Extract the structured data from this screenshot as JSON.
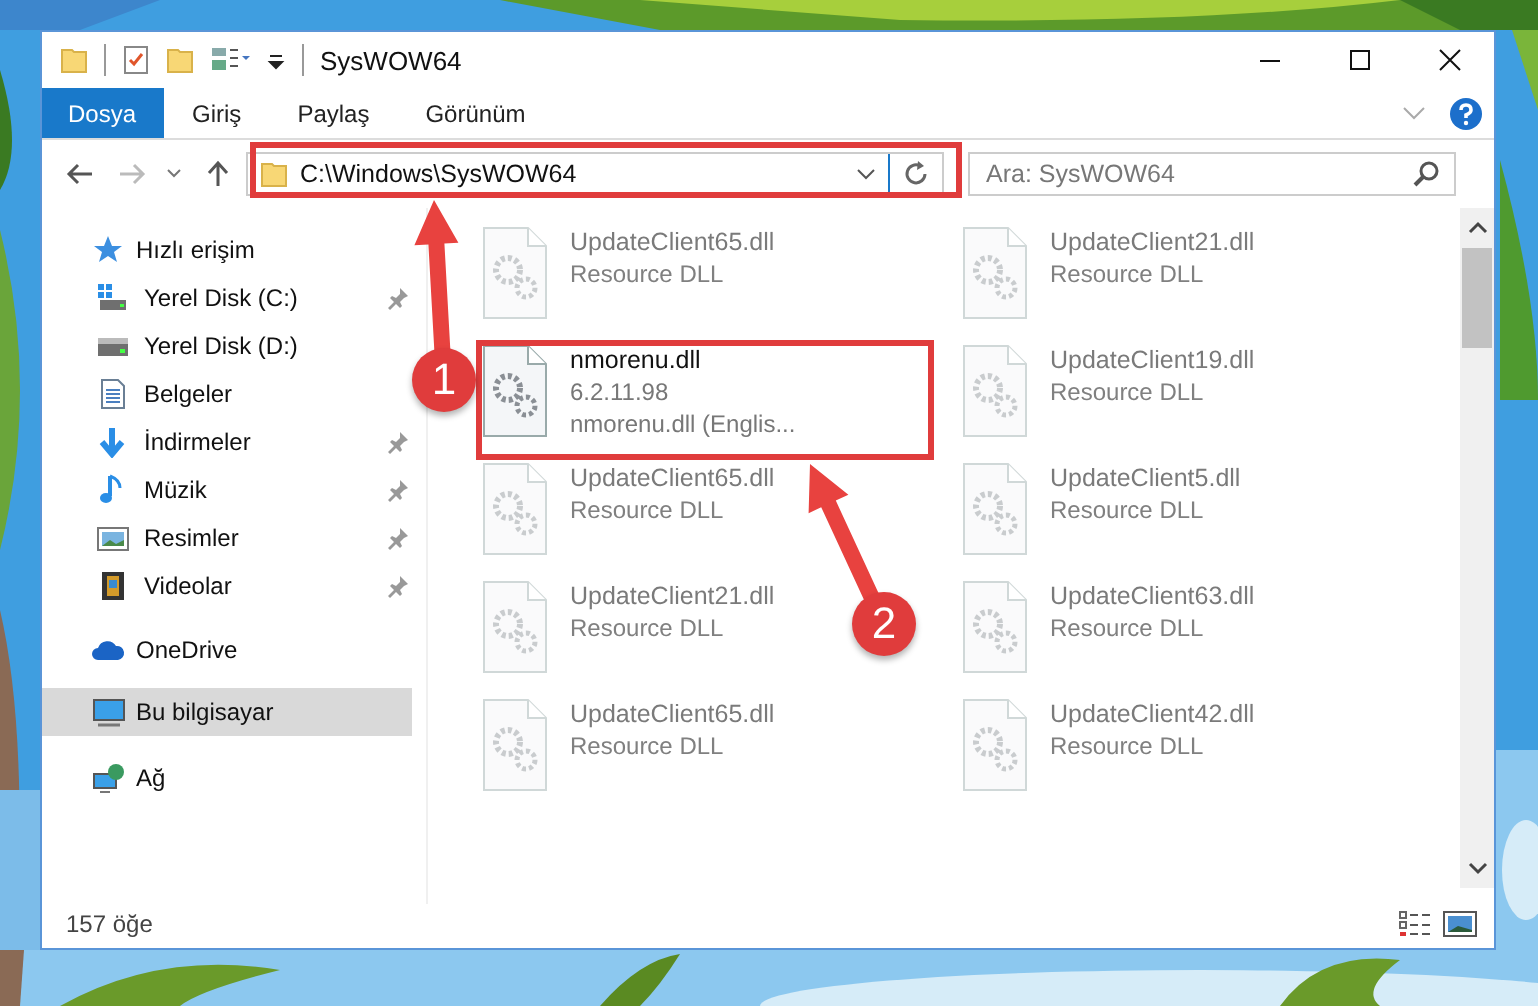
{
  "window": {
    "title": "SysWOW64"
  },
  "ribbon": {
    "tabs": [
      {
        "label": "Dosya",
        "selected": true
      },
      {
        "label": "Giriş",
        "selected": false
      },
      {
        "label": "Paylaş",
        "selected": false
      },
      {
        "label": "Görünüm",
        "selected": false
      }
    ]
  },
  "address_bar": {
    "path": "C:\\Windows\\SysWOW64"
  },
  "search": {
    "placeholder": "Ara: SysWOW64"
  },
  "sidebar": {
    "items": [
      {
        "label": "Hızlı erişim",
        "kind": "star",
        "selected": false,
        "children": [
          {
            "label": "Yerel Disk (C:)",
            "kind": "sysdrive",
            "pinned": true,
            "selected": false
          },
          {
            "label": "Yerel Disk (D:)",
            "kind": "drive",
            "pinned": false,
            "selected": false
          },
          {
            "label": "Belgeler",
            "kind": "document",
            "pinned": false,
            "selected": false
          },
          {
            "label": "İndirmeler",
            "kind": "download",
            "pinned": true,
            "selected": false
          },
          {
            "label": "Müzik",
            "kind": "music",
            "pinned": true,
            "selected": false
          },
          {
            "label": "Resimler",
            "kind": "picture",
            "pinned": true,
            "selected": false
          },
          {
            "label": "Videolar",
            "kind": "video",
            "pinned": true,
            "selected": false
          }
        ]
      },
      {
        "label": "OneDrive",
        "kind": "cloud",
        "selected": false
      },
      {
        "label": "Bu bilgisayar",
        "kind": "computer",
        "selected": true
      },
      {
        "label": "Ağ",
        "kind": "network",
        "selected": false
      }
    ]
  },
  "files": [
    {
      "name": "UpdateClient65.dll",
      "lines": [
        "Resource DLL"
      ],
      "highlighted": false
    },
    {
      "name": "UpdateClient21.dll",
      "lines": [
        "Resource DLL"
      ],
      "highlighted": false
    },
    {
      "name": "nmorenu.dll",
      "lines": [
        "6.2.11.98",
        "nmorenu.dll (Englis..."
      ],
      "highlighted": true
    },
    {
      "name": "UpdateClient19.dll",
      "lines": [
        "Resource DLL"
      ],
      "highlighted": false
    },
    {
      "name": "UpdateClient65.dll",
      "lines": [
        "Resource DLL"
      ],
      "highlighted": false
    },
    {
      "name": "UpdateClient5.dll",
      "lines": [
        "Resource DLL"
      ],
      "highlighted": false
    },
    {
      "name": "UpdateClient21.dll",
      "lines": [
        "Resource DLL"
      ],
      "highlighted": false
    },
    {
      "name": "UpdateClient63.dll",
      "lines": [
        "Resource DLL"
      ],
      "highlighted": false
    },
    {
      "name": "UpdateClient65.dll",
      "lines": [
        "Resource DLL"
      ],
      "highlighted": false
    },
    {
      "name": "UpdateClient42.dll",
      "lines": [
        "Resource DLL"
      ],
      "highlighted": false
    }
  ],
  "status_bar": {
    "count": "157 öğe"
  },
  "annotations": [
    {
      "label": "1"
    },
    {
      "label": "2"
    }
  ]
}
